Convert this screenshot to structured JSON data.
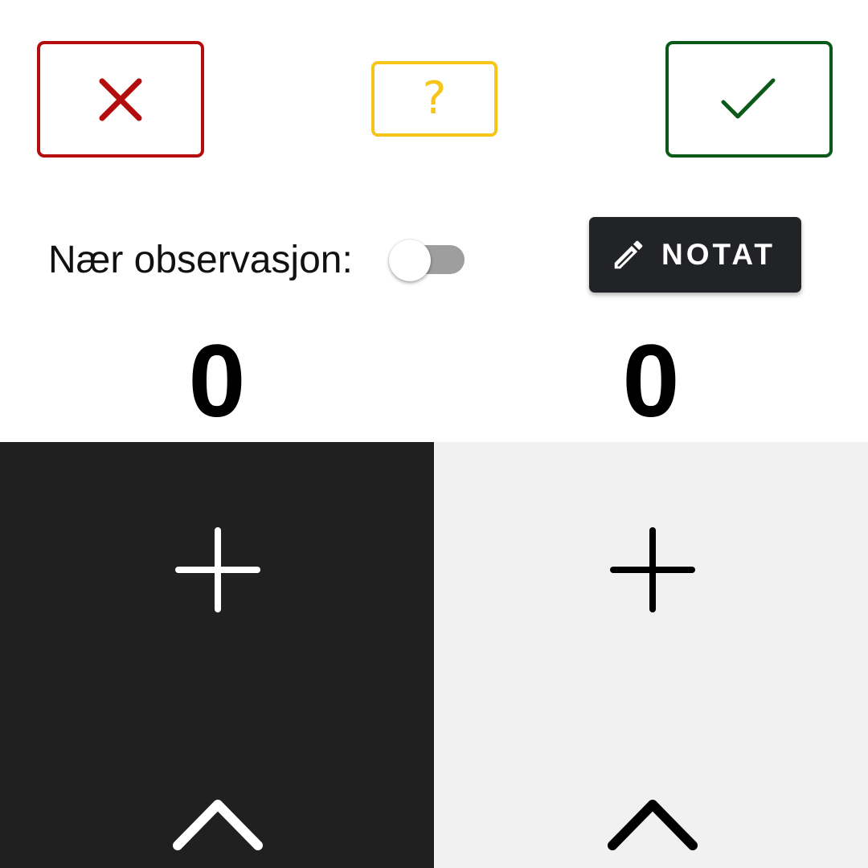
{
  "actions": {
    "reject": {
      "icon": "close-icon",
      "color": "#b30d0d"
    },
    "unsure": {
      "icon": "question-mark-icon",
      "glyph": "?",
      "color": "#f5c518"
    },
    "accept": {
      "icon": "checkmark-icon",
      "color": "#0b5a1a"
    }
  },
  "observation": {
    "label": "Nær observasjon:",
    "toggle_on": false
  },
  "note_button": {
    "label": "NOTAT",
    "icon": "pencil-icon"
  },
  "counters": {
    "left_value": "0",
    "right_value": "0"
  },
  "panels": {
    "left": {
      "background": "#202020",
      "icons": [
        "plus-icon",
        "chevron-up-icon"
      ]
    },
    "right": {
      "background": "#f1f1f1",
      "icons": [
        "plus-icon",
        "chevron-up-icon"
      ]
    }
  }
}
